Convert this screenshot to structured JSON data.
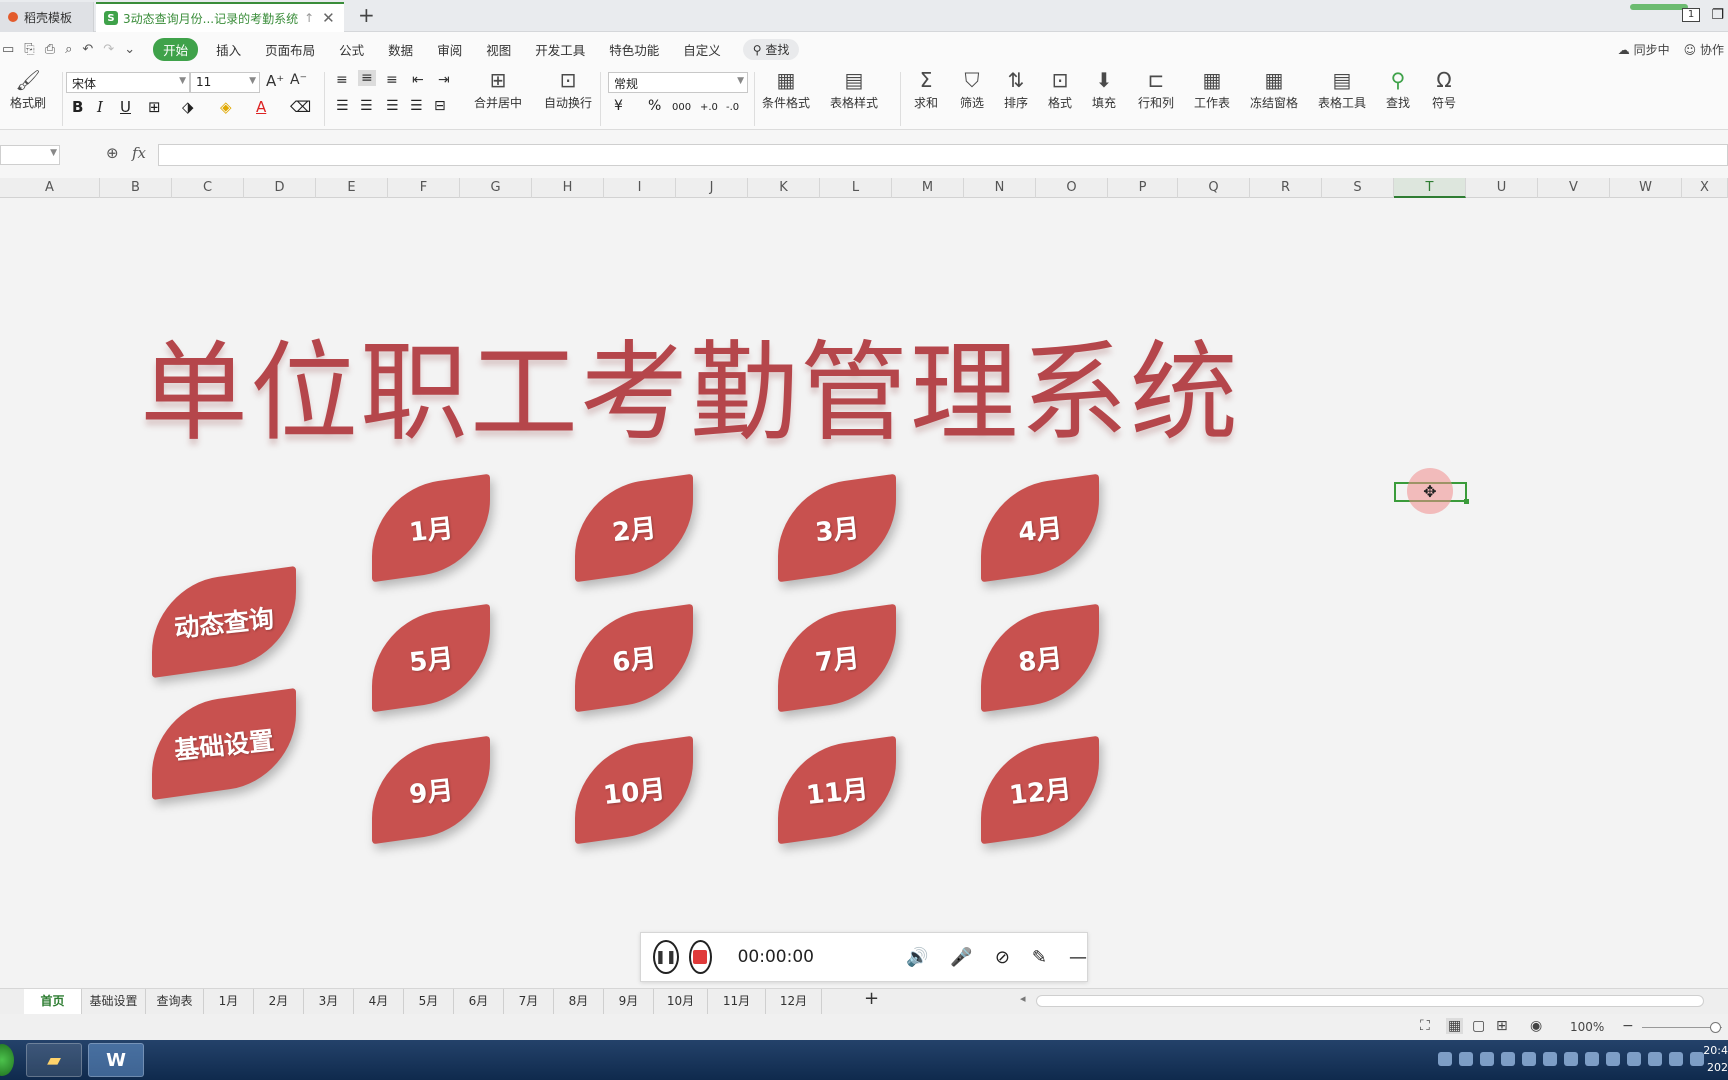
{
  "tabs": {
    "inactive_label": "稻壳模板",
    "active_label": "3动态查询月份...记录的考勤系统",
    "new_tab": "+",
    "window_badge": "1"
  },
  "menu": {
    "items": [
      "开始",
      "插入",
      "页面布局",
      "公式",
      "数据",
      "审阅",
      "视图",
      "开发工具",
      "特色功能",
      "自定义"
    ],
    "search": "查找",
    "right": [
      "同步中",
      "协作"
    ]
  },
  "ribbon": {
    "format_painter": "格式刷",
    "font_name": "宋体",
    "font_size": "11",
    "number_format": "常规",
    "merge_center": "合并居中",
    "wrap_text": "自动换行",
    "conditional_format": "条件格式",
    "table_style": "表格样式",
    "sum": "求和",
    "filter": "筛选",
    "sort": "排序",
    "format": "格式",
    "fill": "填充",
    "row_col": "行和列",
    "worksheet": "工作表",
    "freeze": "冻结窗格",
    "table_tools": "表格工具",
    "find": "查找",
    "symbol": "符号",
    "currency": "¥",
    "percent": "%",
    "thousands": "000",
    "dec_inc": "+.0",
    "dec_dec": "-.0"
  },
  "formula_bar": {
    "fx": "fx",
    "value": ""
  },
  "columns": [
    "A",
    "B",
    "C",
    "D",
    "E",
    "F",
    "G",
    "H",
    "I",
    "J",
    "K",
    "L",
    "M",
    "N",
    "O",
    "P",
    "Q",
    "R",
    "S",
    "T",
    "U",
    "V",
    "W",
    "X"
  ],
  "selected_column": "T",
  "sheet": {
    "title": "单位职工考勤管理系统",
    "side_buttons": [
      "动态查询",
      "基础设置"
    ],
    "months": [
      "1月",
      "2月",
      "3月",
      "4月",
      "5月",
      "6月",
      "7月",
      "8月",
      "9月",
      "10月",
      "11月",
      "12月"
    ],
    "leaf_color": "#c8514f"
  },
  "recorder": {
    "time": "00:00:00"
  },
  "sheet_tabs": [
    "首页",
    "基础设置",
    "查询表",
    "1月",
    "2月",
    "3月",
    "4月",
    "5月",
    "6月",
    "7月",
    "8月",
    "9月",
    "10月",
    "11月",
    "12月"
  ],
  "active_sheet": "首页",
  "status": {
    "zoom": "100%"
  },
  "taskbar": {
    "clock_line1": "20:4",
    "clock_line2": "202"
  },
  "colors": {
    "accent_green": "#3fa24a",
    "title_red": "#b5464b"
  }
}
